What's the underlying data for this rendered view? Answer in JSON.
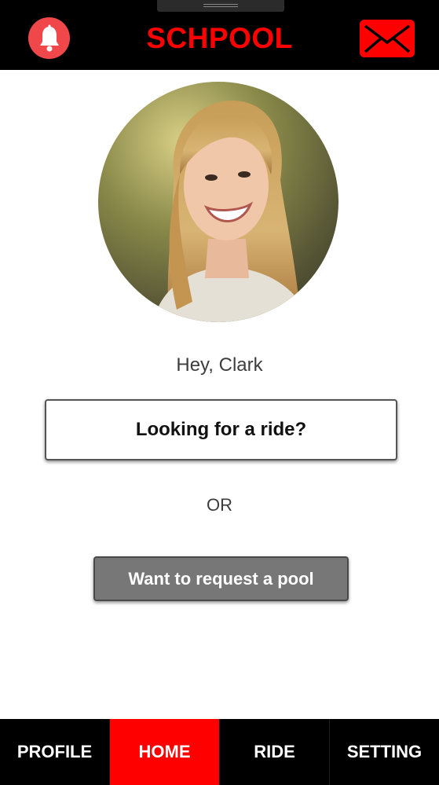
{
  "header": {
    "title": "SCHPOOL",
    "bell_icon": "bell-icon",
    "mail_icon": "envelope-icon",
    "accent_color": "#ff0000",
    "bell_color": "#f0484a"
  },
  "profile": {
    "avatar": "profile-photo",
    "greeting": "Hey, Clark"
  },
  "actions": {
    "ride_label": "Looking for a ride?",
    "or_label": "OR",
    "pool_label": "Want to request a pool"
  },
  "nav": {
    "items": [
      {
        "label": "PROFILE",
        "active": false
      },
      {
        "label": "HOME",
        "active": true
      },
      {
        "label": "RIDE",
        "active": false
      },
      {
        "label": "SETTING",
        "active": false
      }
    ],
    "active_color": "#ff0000"
  }
}
